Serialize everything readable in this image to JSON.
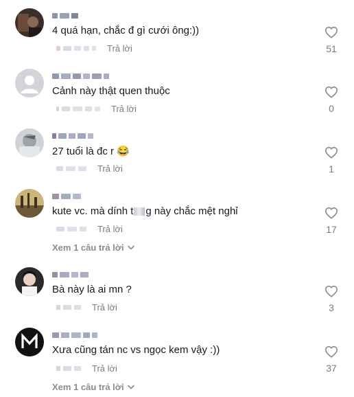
{
  "comments": [
    {
      "text": "4 quá hạn, chắc đ gì cưới ông:))",
      "reply_label": "Trả lời",
      "likes": "51",
      "avatar_icon": "avatar-photo-dark"
    },
    {
      "text": "Cảnh này thật quen thuộc",
      "reply_label": "Trả lời",
      "likes": "0",
      "avatar_icon": "default-avatar-icon"
    },
    {
      "text": "27 tuổi là đc r 😂",
      "reply_label": "Trả lời",
      "likes": "1",
      "avatar_icon": "avatar-photo-gray"
    },
    {
      "text_before": "kute vc. mà dính t",
      "text_after": "g này chắc mệt nghỉ",
      "reply_label": "Trả lời",
      "likes": "17",
      "avatar_icon": "avatar-photo-landscape",
      "view_replies": "Xem 1 câu trả lời"
    },
    {
      "text": "Bà này là ai mn ?",
      "reply_label": "Trả lời",
      "likes": "3",
      "avatar_icon": "avatar-photo-person"
    },
    {
      "text": "Xưa cũng tán nc vs ngọc kem vậy :))",
      "reply_label": "Trả lời",
      "likes": "37",
      "avatar_icon": "avatar-m-logo",
      "view_replies": "Xem 1 câu trả lời"
    }
  ],
  "colors": {
    "text": "#161823",
    "muted": "#7a7b82",
    "heart": "#8a8b91"
  }
}
